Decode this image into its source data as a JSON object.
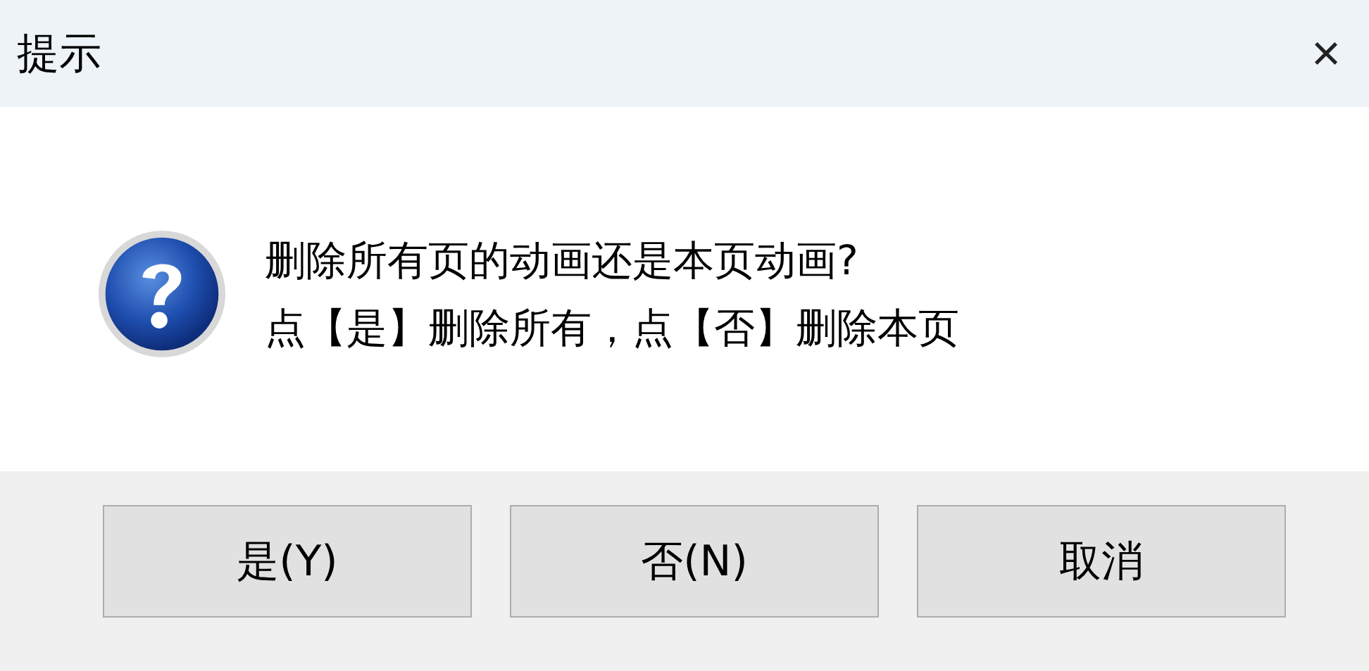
{
  "window": {
    "title": "提示",
    "close": "×"
  },
  "message": {
    "kind": "question",
    "lines": [
      "删除所有页的动画还是本页动画?",
      "点【是】删除所有，点【否】删除本页"
    ]
  },
  "buttons": [
    {
      "label": "是(Y)"
    },
    {
      "label": "否(N)"
    },
    {
      "label": "取消"
    }
  ]
}
